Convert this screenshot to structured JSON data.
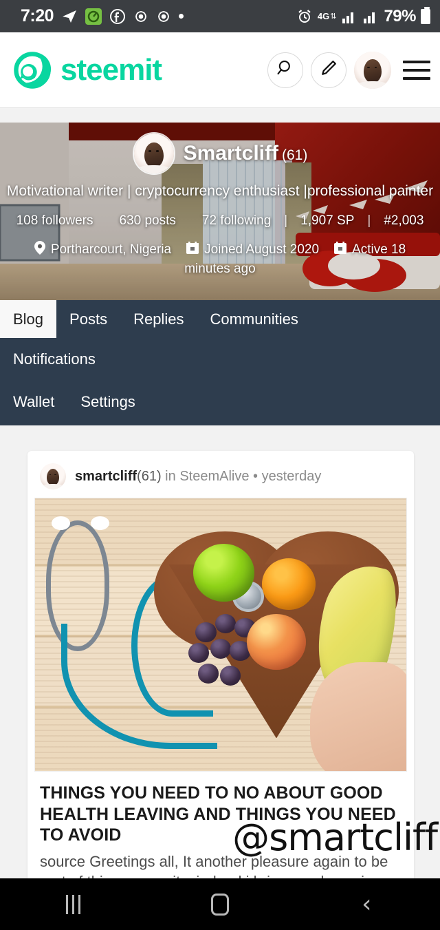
{
  "status_bar": {
    "time": "7:20",
    "left_icons": [
      "telegram-icon",
      "app-green-icon",
      "facebook-icon",
      "clock-app-icon",
      "clock-app-icon-2",
      "dot-icon"
    ],
    "alarm_icon": "alarm-icon",
    "network_type": "4G",
    "signal_icons": [
      "signal-bars-sim1",
      "signal-bars-sim2"
    ],
    "battery_percent": "79%"
  },
  "app_header": {
    "brand": "steemit",
    "brand_color": "#09d6a0",
    "search_icon": "search-icon",
    "compose_icon": "pencil-icon",
    "avatar": "user-avatar",
    "menu_icon": "hamburger-menu-icon"
  },
  "profile": {
    "name": "Smartcliff",
    "reputation": "(61)",
    "about": "Motivational writer | cryptocurrency enthusiast |professional painter",
    "stats": {
      "followers": "108 followers",
      "posts": "630 posts",
      "following": "72 following",
      "steem_power": "1,907 SP",
      "rank": "#2,003"
    },
    "location": "Portharcourt, Nigeria",
    "joined": "Joined August 2020",
    "active": "Active 18",
    "active_wrap": "minutes ago",
    "location_icon": "map-pin-icon",
    "joined_icon": "calendar-icon",
    "active_icon": "calendar-icon"
  },
  "nav": {
    "row1": [
      {
        "label": "Blog",
        "active": true
      },
      {
        "label": "Posts",
        "active": false
      },
      {
        "label": "Replies",
        "active": false
      },
      {
        "label": "Communities",
        "active": false
      }
    ],
    "row2": [
      {
        "label": "Notifications"
      }
    ],
    "row3": [
      {
        "label": "Wallet"
      },
      {
        "label": "Settings"
      }
    ]
  },
  "post": {
    "author": "smartcliff",
    "author_rep": "(61)",
    "in_label": "in",
    "community": "SteemAlive",
    "separator": "•",
    "time": "yesterday",
    "image_alt": "heart-shaped-wooden-bowl-with-fruits-and-stethoscope",
    "title": "THINGS YOU NEED TO NO ABOUT GOOD HEALTH LEAVING AND THINGS YOU NEED TO AVOID",
    "excerpt": "source Greetings all, It another pleasure again to be part of this community ,indeed i bring words again on...",
    "watermark": "@smartcliff"
  },
  "system_nav": {
    "recents": "recents-icon",
    "home": "home-icon",
    "back": "back-icon",
    "back_glyph": "‹"
  }
}
